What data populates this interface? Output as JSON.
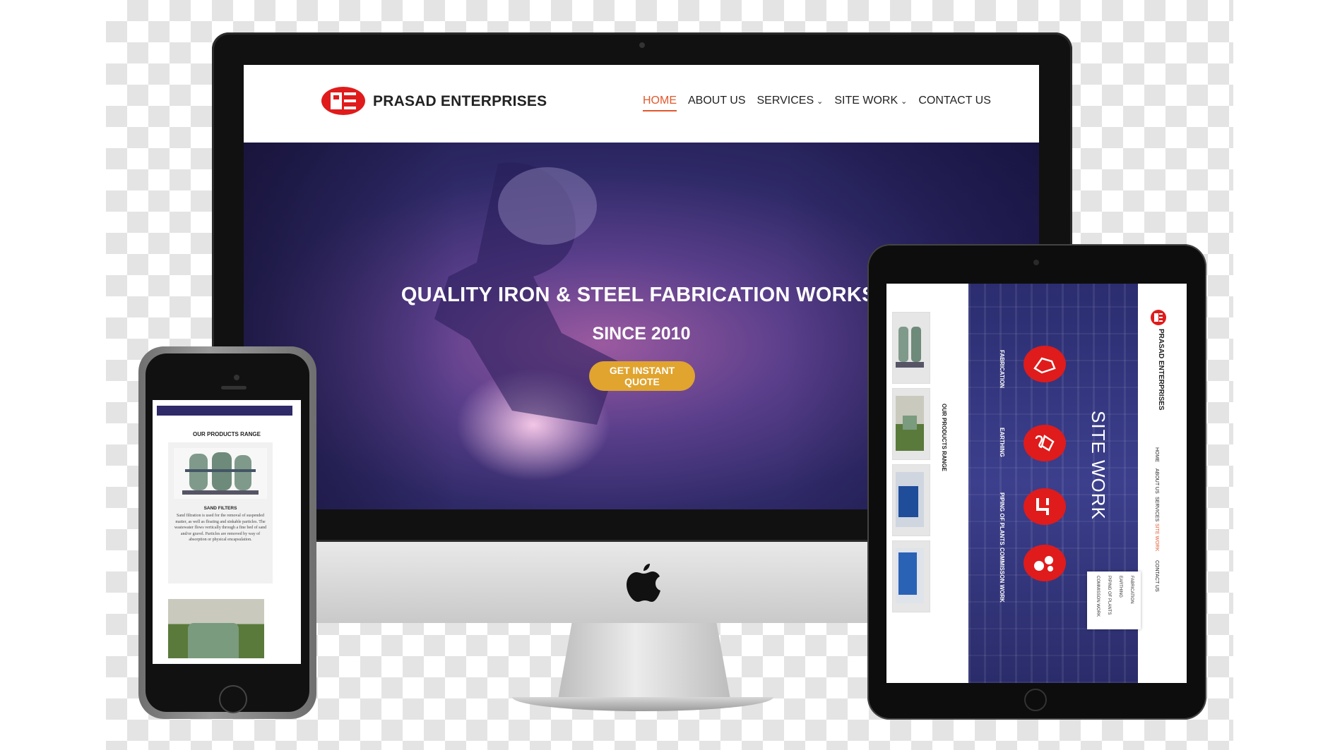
{
  "desktop": {
    "brand": "PRASAD ENTERPRISES",
    "nav": [
      {
        "label": "HOME",
        "active": true
      },
      {
        "label": "ABOUT US"
      },
      {
        "label": "SERVICES",
        "dropdown": true
      },
      {
        "label": "SITE WORK",
        "dropdown": true
      },
      {
        "label": "CONTACT US"
      }
    ],
    "hero_title": "QUALITY IRON & STEEL FABRICATION WORKS.",
    "hero_subtitle": "SINCE 2010",
    "cta_label": "GET INSTANT QUOTE",
    "colors": {
      "accent": "#e2582c",
      "cta": "#e0a42f",
      "hero": "#3a2f78"
    }
  },
  "tablet": {
    "brand": "PRASAD ENTERPRISES",
    "products_title": "OUR PRODUCTS RANGE",
    "site_title": "SITE WORK",
    "services": [
      "FABRICATION",
      "EARTHING",
      "PIPING OF PLANTS",
      "COMMISSON WORK"
    ],
    "nav": [
      "HOME",
      "ABOUT US",
      "SERVICES",
      "SITE WORK",
      "CONTACT US"
    ],
    "dropdown": [
      "FABRICATION",
      "EARTHING",
      "PIPING OF PLANTS",
      "COMMISSON WORK"
    ]
  },
  "phone": {
    "products_title": "OUR PRODUCTS RANGE",
    "product_name": "SAND FILTERS",
    "product_desc": "Sand filtration is used for the removal of suspended matter, as well as floating and sinkable particles. The wastewater flows vertically through a fine bed of sand and/or gravel. Particles are removed by way of absorption or physical encapsulation."
  }
}
